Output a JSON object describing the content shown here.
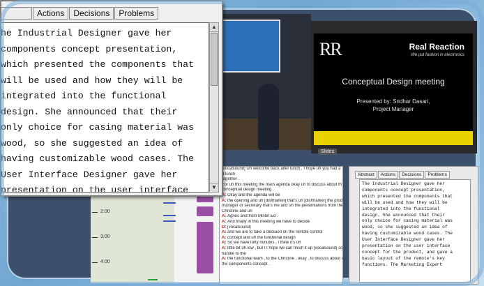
{
  "zoom_panel": {
    "tabs": [
      "",
      "Actions",
      "Decisions",
      "Problems"
    ],
    "text_lines": [
      "he Industrial Designer gave her",
      "components concept presentation,",
      "which presented the components that",
      "will be used and how they will be",
      "integrated into the functional",
      "design. She announced that their",
      "only choice for casing material was",
      "wood, so she suggested an idea of",
      "having customizable wood cases. The",
      "User Interface Designer gave her",
      "presentation on the user interface",
      "concept for the product, and gave a",
      "basic layout of the remote's key"
    ]
  },
  "timeline": {
    "labels": [
      "2:00",
      "3:00",
      "4:00"
    ]
  },
  "slide": {
    "logo": "RR",
    "brand": "Real Reaction",
    "tagline": "We put fashion in electronics",
    "title": "Conceptual Design meeting",
    "presenter_line1": "Presented by: Sridhar Dasari,",
    "presenter_line2": "Project Manager",
    "tab_label": "Slides"
  },
  "transcript": {
    "lines": [
      {
        "speaker": "",
        "text": "[vocalsound] Uh welcome back after lunch , I hope uh you had a"
      },
      {
        "speaker": "",
        "text": "d lunch"
      },
      {
        "speaker": "",
        "text": "together ."
      },
      {
        "speaker": "",
        "text": "For uh this meeting the main agenda okay uh to discuss about th"
      },
      {
        "speaker": "",
        "text": "conceptual design meeting ."
      },
      {
        "speaker": "A:",
        "text": "Okay and the agenda will be"
      },
      {
        "speaker": "A:",
        "text": "the opening and uh [disfmarker] that's uh [disfmarker] the produ"
      },
      {
        "speaker": "",
        "text": "manager or secretary that's me and uh the presentations from the"
      },
      {
        "speaker": "",
        "text": "Christine and uh"
      },
      {
        "speaker": "A:",
        "text": "Agnes and from Mister Ed ."
      },
      {
        "speaker": "A:",
        "text": "And finally in this meeting we have to decide"
      },
      {
        "speaker": "D:",
        "text": "[vocalsound]"
      },
      {
        "speaker": "A:",
        "text": "and we are to take a decision on the remote control"
      },
      {
        "speaker": "A:",
        "text": "concept and uh the functional design"
      },
      {
        "speaker": "A:",
        "text": "So we have forty minutes , I think it's uh"
      },
      {
        "speaker": "A:",
        "text": "little bit uh low , but I I hope we can finish it up [vocalsound] so"
      },
      {
        "speaker": "",
        "text": "handle to the"
      },
      {
        "speaker": "A:",
        "text": "the functional team , to the Christine , okay , to discuss about u"
      },
      {
        "speaker": "",
        "text": "the components concept ."
      }
    ]
  },
  "summary_panel": {
    "tabs": [
      "Abstract",
      "Actions",
      "Decisions",
      "Problems"
    ],
    "text_lines": [
      "The Industrial Designer gave her",
      "components concept presentation,",
      "which presented the components that",
      "will be used and how they will be",
      "integrated into the functional",
      "design. She announced that their",
      "only choice for casing material was",
      "wood, so she suggested an idea of",
      "having customizable wood cases. The",
      "User Interface Designer gave her",
      "presentation on the user interface",
      "concept for the product, and gave a",
      "basic layout of the remote's key",
      "functions. The Marketing Expert"
    ]
  },
  "colors": {
    "frame": "#6ea6cf",
    "speaker": "#dd0000",
    "timeline_bar": "#9a4fa4",
    "timeline_thin": "#3f59c4",
    "slide_accent": "#e8d300"
  }
}
